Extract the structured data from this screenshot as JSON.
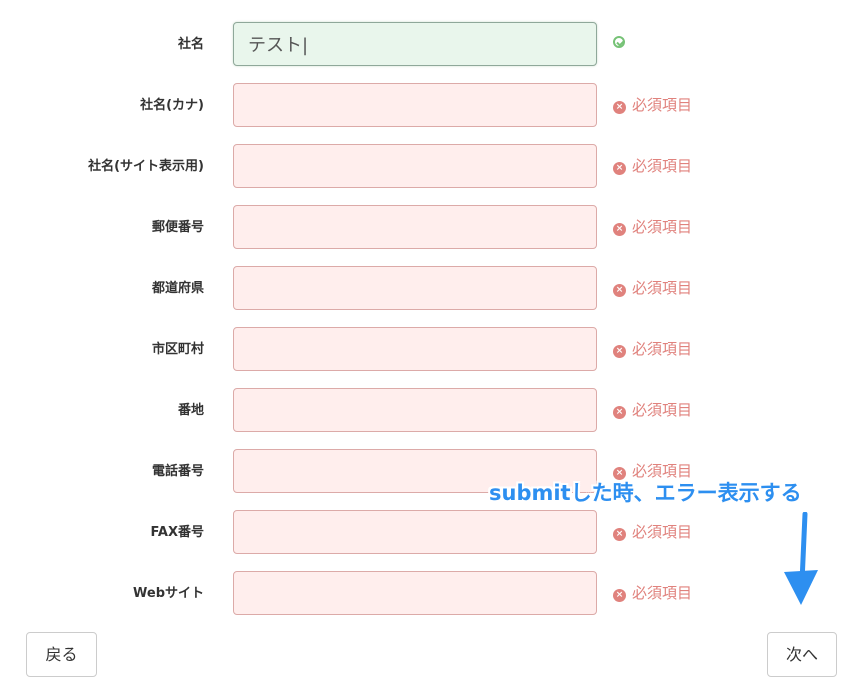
{
  "form": {
    "rows": [
      {
        "label": "社名",
        "value": "テスト|",
        "status": "",
        "valid": true
      },
      {
        "label": "社名(カナ)",
        "value": "",
        "status": "必須項目",
        "valid": false
      },
      {
        "label": "社名(サイト表示用)",
        "value": "",
        "status": "必須項目",
        "valid": false
      },
      {
        "label": "郵便番号",
        "value": "",
        "status": "必須項目",
        "valid": false
      },
      {
        "label": "都道府県",
        "value": "",
        "status": "必須項目",
        "valid": false
      },
      {
        "label": "市区町村",
        "value": "",
        "status": "必須項目",
        "valid": false
      },
      {
        "label": "番地",
        "value": "",
        "status": "必須項目",
        "valid": false
      },
      {
        "label": "電話番号",
        "value": "",
        "status": "必須項目",
        "valid": false
      },
      {
        "label": "FAX番号",
        "value": "",
        "status": "必須項目",
        "valid": false
      },
      {
        "label": "Webサイト",
        "value": "",
        "status": "必須項目",
        "valid": false
      }
    ]
  },
  "buttons": {
    "back_label": "戻る",
    "next_label": "次へ"
  },
  "annotation": {
    "text": "submitした時、エラー表示する"
  },
  "colors": {
    "error": "#e0827d",
    "error_bg": "#ffeeed",
    "valid_bg": "#e9f6ec",
    "valid_icon": "#76c276",
    "annotation": "#2d8ff0"
  }
}
